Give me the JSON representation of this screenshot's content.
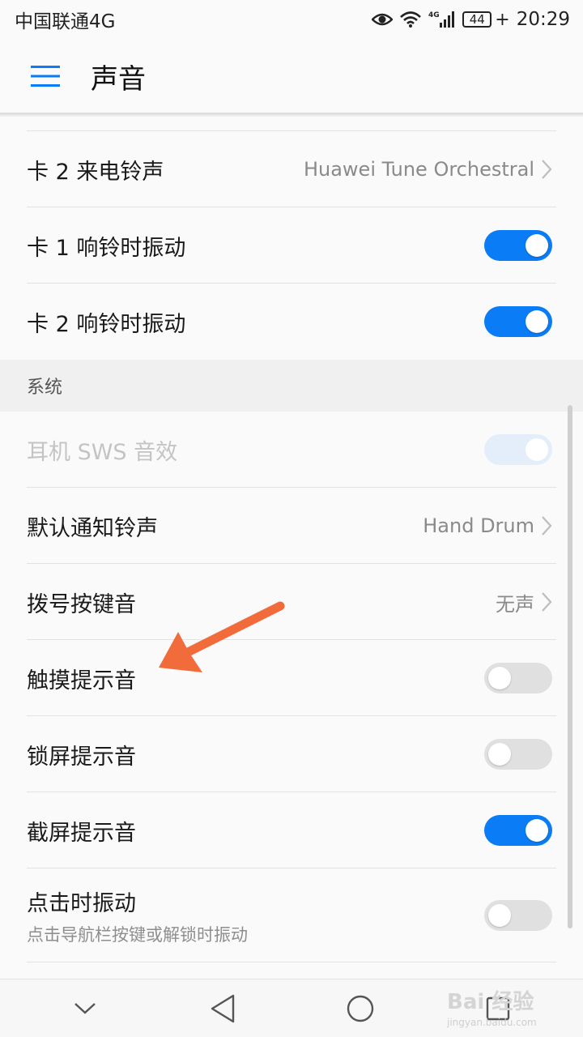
{
  "status_bar": {
    "carrier": "中国联通4G",
    "network_badge": "4G",
    "battery": "44",
    "time": "20:29",
    "icons": [
      "eye-icon",
      "wifi-icon",
      "signal-icon",
      "battery-icon"
    ]
  },
  "header": {
    "title": "声音",
    "menu_icon": "hamburger-menu-icon"
  },
  "rows_top": [
    {
      "label": "卡 2 来电铃声",
      "value": "Huawei Tune Orchestral"
    },
    {
      "label": "卡 1 响铃时振动",
      "toggle": "on"
    },
    {
      "label": "卡 2 响铃时振动",
      "toggle": "on"
    }
  ],
  "section": {
    "title": "系统"
  },
  "rows_system": [
    {
      "label": "耳机 SWS 音效",
      "toggle": "disabled-on"
    },
    {
      "label": "默认通知铃声",
      "value": "Hand Drum"
    },
    {
      "label": "拨号按键音",
      "value": "无声"
    },
    {
      "label": "触摸提示音",
      "toggle": "off"
    },
    {
      "label": "锁屏提示音",
      "toggle": "off"
    },
    {
      "label": "截屏提示音",
      "toggle": "on"
    },
    {
      "label": "点击时振动",
      "sub": "点击导航栏按键或解锁时振动",
      "toggle": "off"
    }
  ],
  "colors": {
    "accent": "#0a7cf5",
    "annotation_arrow": "#f26b3a"
  },
  "nav_bar": {
    "icons": [
      "chevron-down-icon",
      "back-icon",
      "home-icon",
      "recents-icon"
    ]
  },
  "watermark": {
    "text": "Bai 经验",
    "sub": "jingyan.baidu.com"
  }
}
